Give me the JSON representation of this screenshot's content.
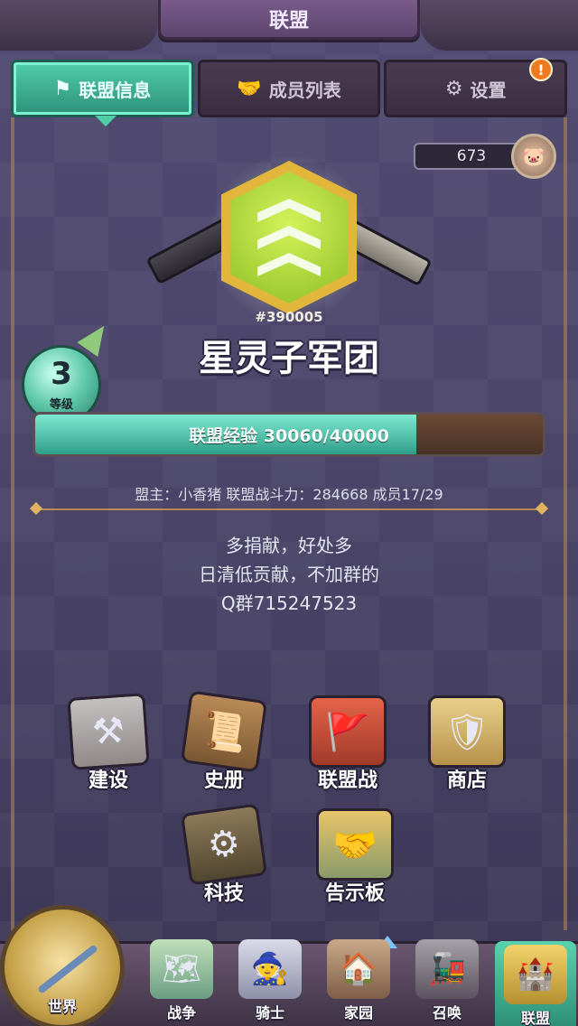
{
  "header": {
    "title": "联盟"
  },
  "tabs": [
    {
      "label": "联盟信息",
      "icon": "flag-icon",
      "active": true
    },
    {
      "label": "成员列表",
      "icon": "handshake-icon",
      "active": false
    },
    {
      "label": "设置",
      "icon": "gear-icon",
      "active": false
    }
  ],
  "alert": {
    "symbol": "!"
  },
  "points": {
    "value": "673"
  },
  "guild": {
    "id": "#390005",
    "name": "星灵子军团",
    "level": "3",
    "level_label": "等级",
    "exp_label": "联盟经验 30060/40000",
    "exp_progress": 0.7515,
    "leader_label": "盟主：",
    "leader_name": "小香猪",
    "power_label": "联盟战斗力：",
    "power_value": "284668",
    "members_label": "成员",
    "members_value": "17/29"
  },
  "notice": {
    "lines": [
      "多捐献，好处多",
      "日清低贡献，不加群的",
      "Q群715247523"
    ]
  },
  "menu": {
    "build": "建设",
    "history": "史册",
    "guild_war": "联盟战",
    "shop": "商店",
    "tech": "科技",
    "board": "告示板"
  },
  "nav": {
    "world": "世界",
    "war": "战争",
    "knight": "骑士",
    "home": "家园",
    "summon": "召唤",
    "alliance": "联盟"
  },
  "colors": {
    "accent": "#4fcfa8",
    "gold": "#e2b63a",
    "background": "#4a4468",
    "alert": "#f07a1f"
  }
}
